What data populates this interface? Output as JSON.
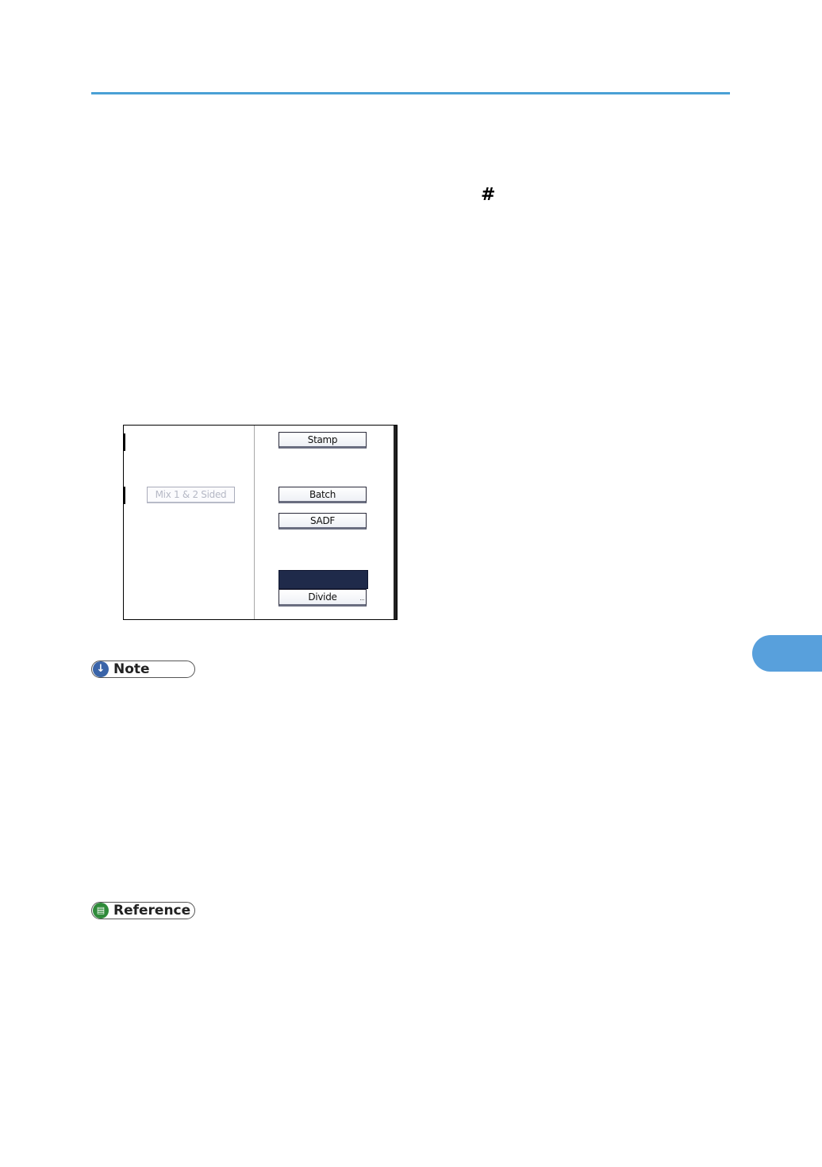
{
  "top_symbol": "#",
  "panel": {
    "buttons": {
      "mix": "Mix 1 & 2 Sided",
      "stamp": "Stamp",
      "batch": "Batch",
      "sadf": "SADF",
      "divide": "Divide"
    }
  },
  "note": {
    "label": "Note",
    "icon": "down-arrow-icon"
  },
  "reference": {
    "label": "Reference",
    "icon": "document-icon"
  },
  "colors": {
    "rule": "#4aa0d5",
    "note_icon": "#3a64a8",
    "reference_icon": "#2f8a3a",
    "side_tab": "#58a0dc",
    "selected_block": "#1f2a4a"
  }
}
